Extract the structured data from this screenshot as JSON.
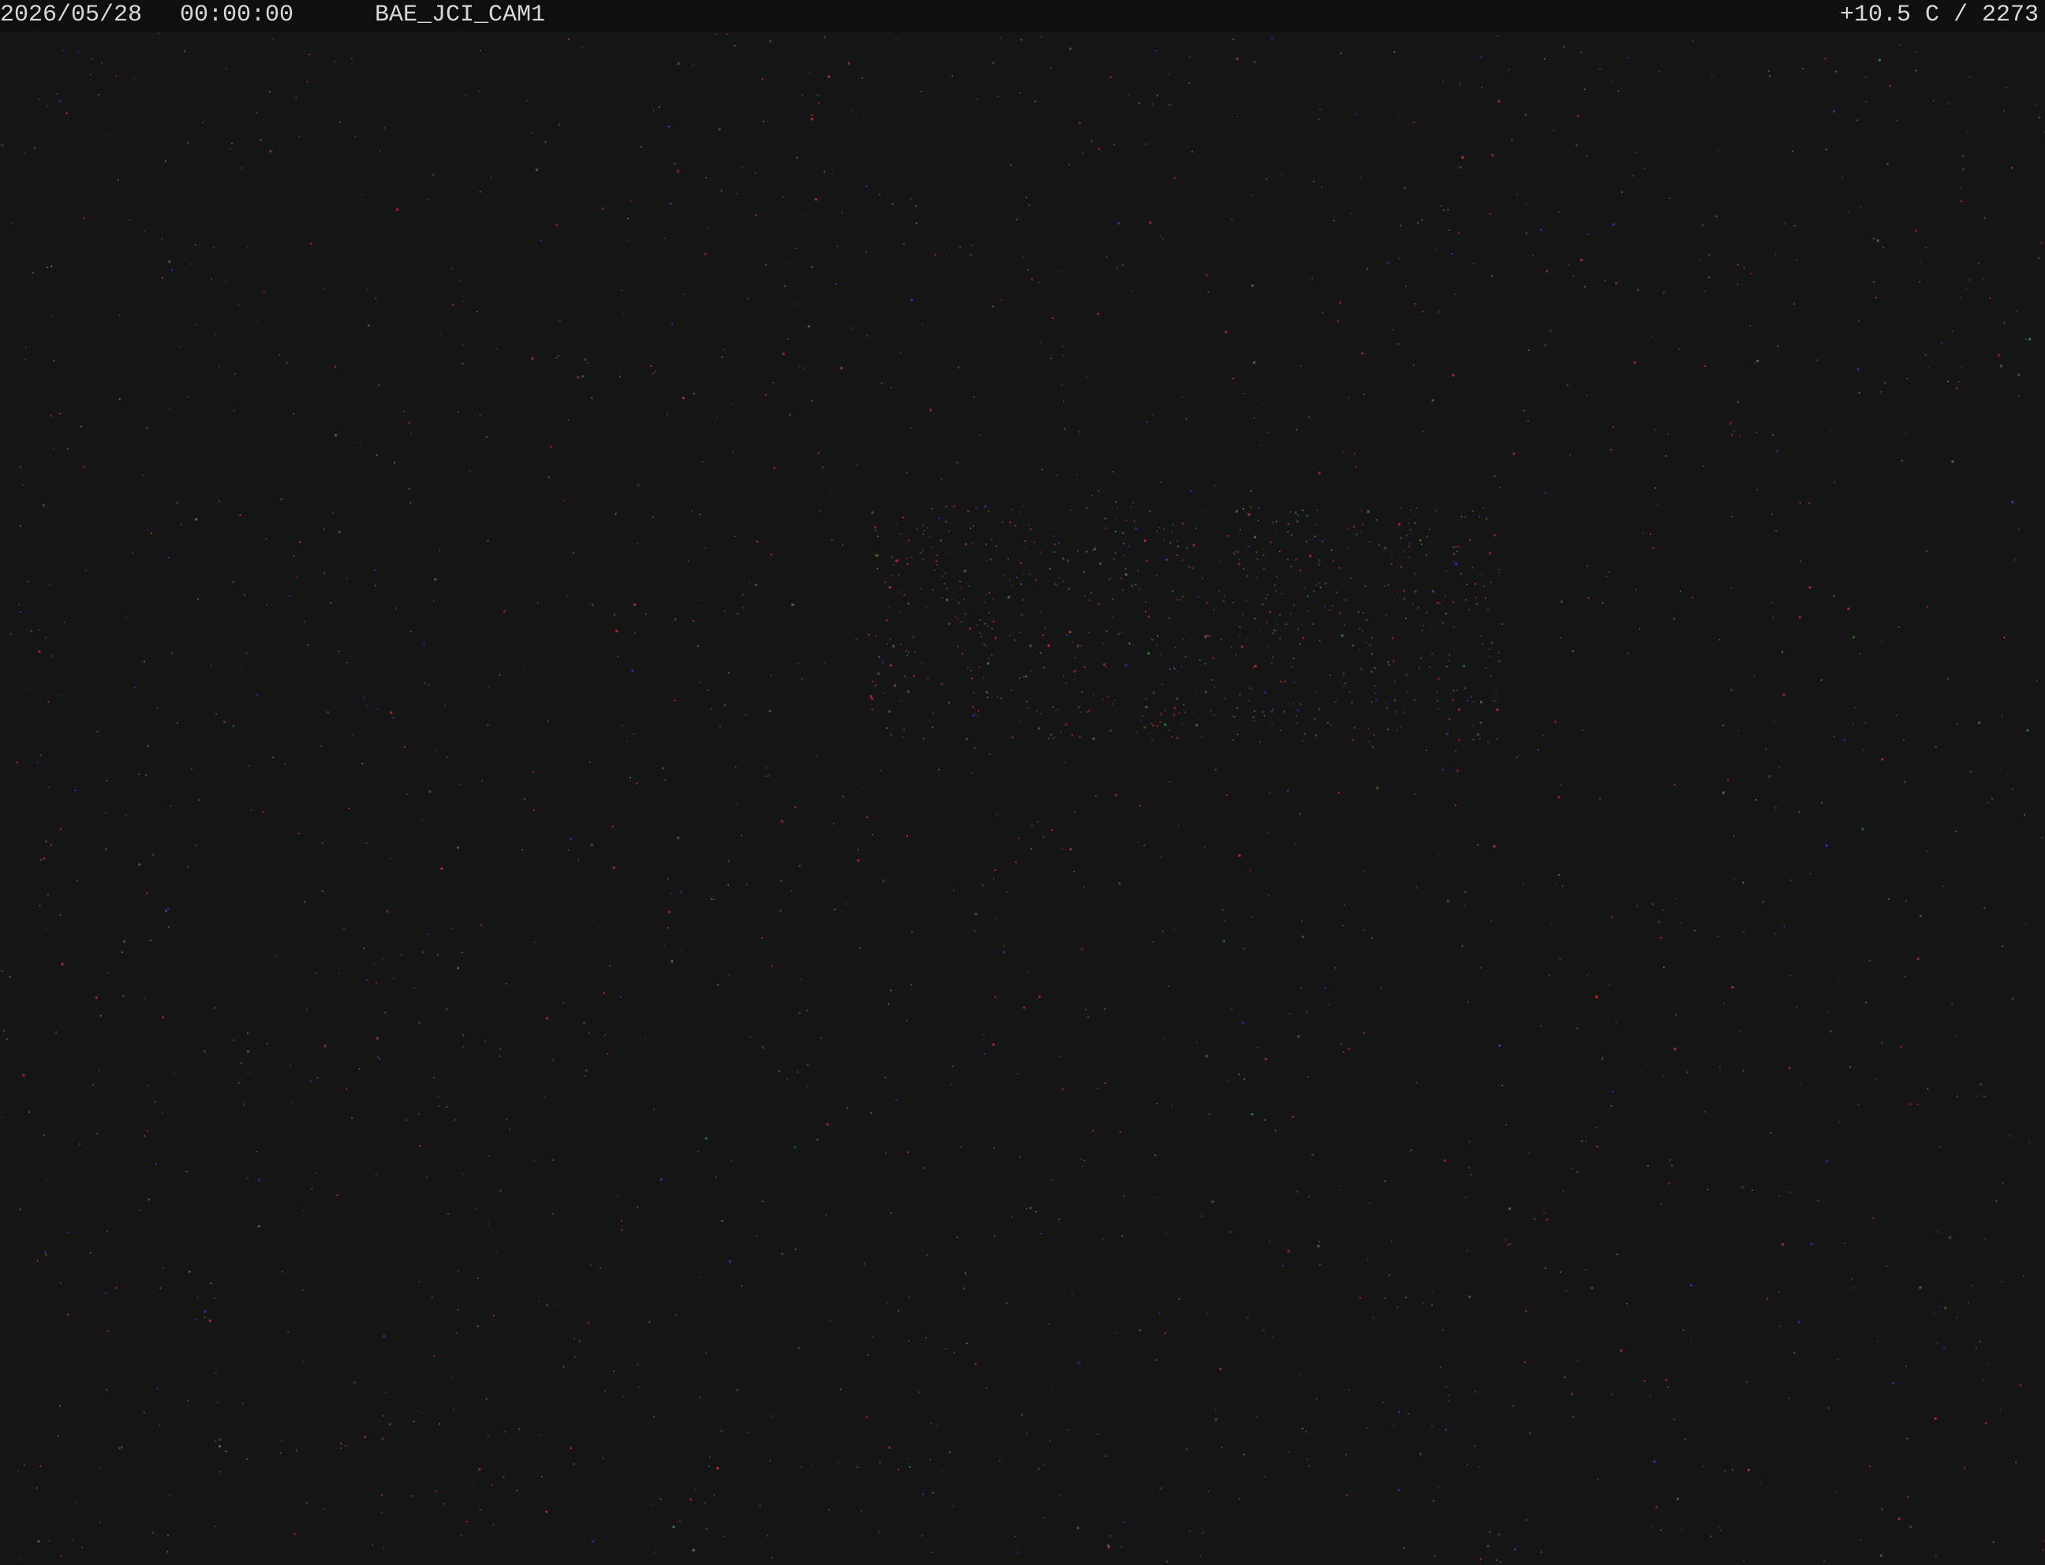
{
  "overlay": {
    "date": "2026/05/28",
    "time": "00:00:00",
    "camera": "BAE_JCI_CAM1",
    "reading": "+10.5 C / 2273"
  },
  "colors": {
    "sky_background": "#151515",
    "overlay_bar": "#0f0f0f",
    "overlay_text": "#d8d8d8",
    "noise_red": "#c8323a",
    "noise_green": "#3c8c46",
    "noise_blue": "#3a3ac8"
  }
}
